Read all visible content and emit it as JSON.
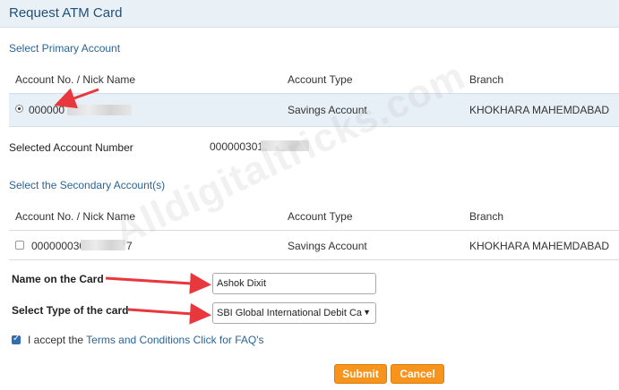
{
  "header": {
    "title": "Request ATM Card"
  },
  "primary": {
    "section_title": "Select Primary Account",
    "columns": [
      "Account No. / Nick Name",
      "Account Type",
      "Branch"
    ],
    "row": {
      "account_no": "000000",
      "account_type": "Savings Account",
      "branch": "KHOKHARA MAHEMDABAD"
    }
  },
  "selected_account": {
    "label": "Selected Account Number",
    "value": "000000301"
  },
  "secondary": {
    "section_title": "Select the Secondary Account(s)",
    "columns": [
      "Account No. / Nick Name",
      "Account Type",
      "Branch"
    ],
    "row": {
      "account_no_prefix": "000000030",
      "account_no_suffix": "7",
      "account_type": "Savings Account",
      "branch": "KHOKHARA MAHEMDABAD"
    }
  },
  "form": {
    "name_label": "Name on the Card",
    "name_value": "Ashok Dixit",
    "type_label": "Select Type of the card",
    "type_value": "SBI Global International Debit Ca"
  },
  "terms": {
    "prefix": "I accept the",
    "link1": "Terms and Conditions",
    "link2": "Click for FAQ's"
  },
  "buttons": {
    "submit": "Submit",
    "cancel": "Cancel"
  },
  "watermark": "Alldigitaltricks.com",
  "colors": {
    "accent": "#f7941d",
    "header_bg": "#e9f1f6",
    "link": "#2a6496",
    "arrow": "#e8383d"
  }
}
